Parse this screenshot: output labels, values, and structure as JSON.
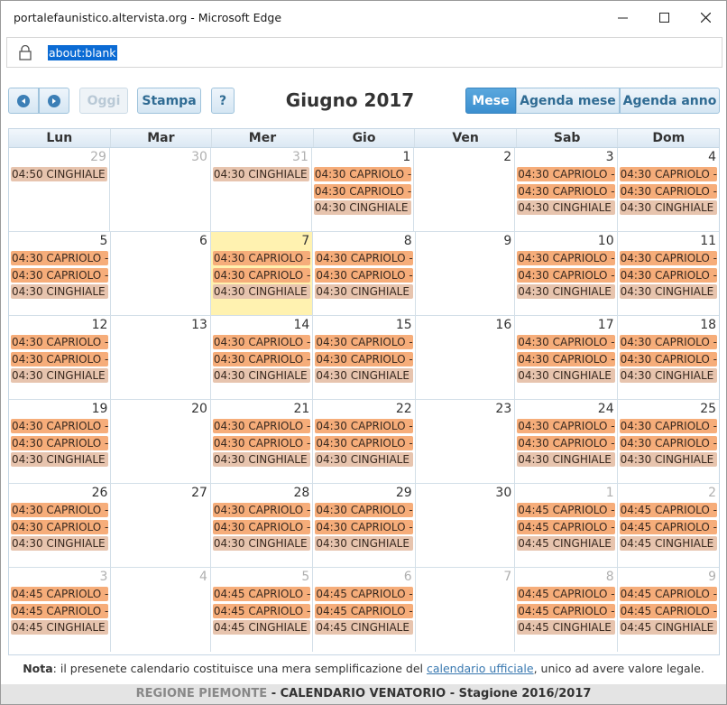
{
  "window": {
    "title": "portalefaunistico.altervista.org - Microsoft Edge",
    "url": "about:blank"
  },
  "toolbar": {
    "today_label": "Oggi",
    "print_label": "Stampa",
    "help_label": "?",
    "title": "Giugno 2017",
    "views": [
      "Mese",
      "Agenda mese",
      "Agenda anno"
    ],
    "active_view": "Mese"
  },
  "calendar": {
    "weekdays": [
      "Lun",
      "Mar",
      "Mer",
      "Gio",
      "Ven",
      "Sab",
      "Dom"
    ],
    "weeks": [
      [
        {
          "day": "29",
          "other": true,
          "events": [
            {
              "text": "04:50 CINGHIALE",
              "type": "cinghiale"
            }
          ]
        },
        {
          "day": "30",
          "other": true,
          "events": []
        },
        {
          "day": "31",
          "other": true,
          "events": [
            {
              "text": "04:30 CINGHIALE",
              "type": "cinghiale"
            }
          ]
        },
        {
          "day": "1",
          "events": [
            {
              "text": "04:30 CAPRIOLO -",
              "type": "capriolo"
            },
            {
              "text": "04:30 CAPRIOLO -",
              "type": "capriolo"
            },
            {
              "text": "04:30 CINGHIALE",
              "type": "cinghiale"
            }
          ]
        },
        {
          "day": "2",
          "events": []
        },
        {
          "day": "3",
          "events": [
            {
              "text": "04:30 CAPRIOLO -",
              "type": "capriolo"
            },
            {
              "text": "04:30 CAPRIOLO -",
              "type": "capriolo"
            },
            {
              "text": "04:30 CINGHIALE",
              "type": "cinghiale"
            }
          ]
        },
        {
          "day": "4",
          "events": [
            {
              "text": "04:30 CAPRIOLO -",
              "type": "capriolo"
            },
            {
              "text": "04:30 CAPRIOLO -",
              "type": "capriolo"
            },
            {
              "text": "04:30 CINGHIALE",
              "type": "cinghiale"
            }
          ]
        }
      ],
      [
        {
          "day": "5",
          "events": [
            {
              "text": "04:30 CAPRIOLO -",
              "type": "capriolo"
            },
            {
              "text": "04:30 CAPRIOLO -",
              "type": "capriolo"
            },
            {
              "text": "04:30 CINGHIALE",
              "type": "cinghiale"
            }
          ]
        },
        {
          "day": "6",
          "events": []
        },
        {
          "day": "7",
          "today": true,
          "events": [
            {
              "text": "04:30 CAPRIOLO -",
              "type": "capriolo"
            },
            {
              "text": "04:30 CAPRIOLO -",
              "type": "capriolo"
            },
            {
              "text": "04:30 CINGHIALE",
              "type": "cinghiale"
            }
          ]
        },
        {
          "day": "8",
          "events": [
            {
              "text": "04:30 CAPRIOLO -",
              "type": "capriolo"
            },
            {
              "text": "04:30 CAPRIOLO -",
              "type": "capriolo"
            },
            {
              "text": "04:30 CINGHIALE",
              "type": "cinghiale"
            }
          ]
        },
        {
          "day": "9",
          "events": []
        },
        {
          "day": "10",
          "events": [
            {
              "text": "04:30 CAPRIOLO -",
              "type": "capriolo"
            },
            {
              "text": "04:30 CAPRIOLO -",
              "type": "capriolo"
            },
            {
              "text": "04:30 CINGHIALE",
              "type": "cinghiale"
            }
          ]
        },
        {
          "day": "11",
          "events": [
            {
              "text": "04:30 CAPRIOLO -",
              "type": "capriolo"
            },
            {
              "text": "04:30 CAPRIOLO -",
              "type": "capriolo"
            },
            {
              "text": "04:30 CINGHIALE",
              "type": "cinghiale"
            }
          ]
        }
      ],
      [
        {
          "day": "12",
          "events": [
            {
              "text": "04:30 CAPRIOLO -",
              "type": "capriolo"
            },
            {
              "text": "04:30 CAPRIOLO -",
              "type": "capriolo"
            },
            {
              "text": "04:30 CINGHIALE",
              "type": "cinghiale"
            }
          ]
        },
        {
          "day": "13",
          "events": []
        },
        {
          "day": "14",
          "events": [
            {
              "text": "04:30 CAPRIOLO -",
              "type": "capriolo"
            },
            {
              "text": "04:30 CAPRIOLO -",
              "type": "capriolo"
            },
            {
              "text": "04:30 CINGHIALE",
              "type": "cinghiale"
            }
          ]
        },
        {
          "day": "15",
          "events": [
            {
              "text": "04:30 CAPRIOLO -",
              "type": "capriolo"
            },
            {
              "text": "04:30 CAPRIOLO -",
              "type": "capriolo"
            },
            {
              "text": "04:30 CINGHIALE",
              "type": "cinghiale"
            }
          ]
        },
        {
          "day": "16",
          "events": []
        },
        {
          "day": "17",
          "events": [
            {
              "text": "04:30 CAPRIOLO -",
              "type": "capriolo"
            },
            {
              "text": "04:30 CAPRIOLO -",
              "type": "capriolo"
            },
            {
              "text": "04:30 CINGHIALE",
              "type": "cinghiale"
            }
          ]
        },
        {
          "day": "18",
          "events": [
            {
              "text": "04:30 CAPRIOLO -",
              "type": "capriolo"
            },
            {
              "text": "04:30 CAPRIOLO -",
              "type": "capriolo"
            },
            {
              "text": "04:30 CINGHIALE",
              "type": "cinghiale"
            }
          ]
        }
      ],
      [
        {
          "day": "19",
          "events": [
            {
              "text": "04:30 CAPRIOLO -",
              "type": "capriolo"
            },
            {
              "text": "04:30 CAPRIOLO -",
              "type": "capriolo"
            },
            {
              "text": "04:30 CINGHIALE",
              "type": "cinghiale"
            }
          ]
        },
        {
          "day": "20",
          "events": []
        },
        {
          "day": "21",
          "events": [
            {
              "text": "04:30 CAPRIOLO -",
              "type": "capriolo"
            },
            {
              "text": "04:30 CAPRIOLO -",
              "type": "capriolo"
            },
            {
              "text": "04:30 CINGHIALE",
              "type": "cinghiale"
            }
          ]
        },
        {
          "day": "22",
          "events": [
            {
              "text": "04:30 CAPRIOLO -",
              "type": "capriolo"
            },
            {
              "text": "04:30 CAPRIOLO -",
              "type": "capriolo"
            },
            {
              "text": "04:30 CINGHIALE",
              "type": "cinghiale"
            }
          ]
        },
        {
          "day": "23",
          "events": []
        },
        {
          "day": "24",
          "events": [
            {
              "text": "04:30 CAPRIOLO -",
              "type": "capriolo"
            },
            {
              "text": "04:30 CAPRIOLO -",
              "type": "capriolo"
            },
            {
              "text": "04:30 CINGHIALE",
              "type": "cinghiale"
            }
          ]
        },
        {
          "day": "25",
          "events": [
            {
              "text": "04:30 CAPRIOLO -",
              "type": "capriolo"
            },
            {
              "text": "04:30 CAPRIOLO -",
              "type": "capriolo"
            },
            {
              "text": "04:30 CINGHIALE",
              "type": "cinghiale"
            }
          ]
        }
      ],
      [
        {
          "day": "26",
          "events": [
            {
              "text": "04:30 CAPRIOLO -",
              "type": "capriolo"
            },
            {
              "text": "04:30 CAPRIOLO -",
              "type": "capriolo"
            },
            {
              "text": "04:30 CINGHIALE",
              "type": "cinghiale"
            }
          ]
        },
        {
          "day": "27",
          "events": []
        },
        {
          "day": "28",
          "events": [
            {
              "text": "04:30 CAPRIOLO -",
              "type": "capriolo"
            },
            {
              "text": "04:30 CAPRIOLO -",
              "type": "capriolo"
            },
            {
              "text": "04:30 CINGHIALE",
              "type": "cinghiale"
            }
          ]
        },
        {
          "day": "29",
          "events": [
            {
              "text": "04:30 CAPRIOLO -",
              "type": "capriolo"
            },
            {
              "text": "04:30 CAPRIOLO -",
              "type": "capriolo"
            },
            {
              "text": "04:30 CINGHIALE",
              "type": "cinghiale"
            }
          ]
        },
        {
          "day": "30",
          "events": []
        },
        {
          "day": "1",
          "other": true,
          "events": [
            {
              "text": "04:45 CAPRIOLO -",
              "type": "capriolo"
            },
            {
              "text": "04:45 CAPRIOLO -",
              "type": "capriolo"
            },
            {
              "text": "04:45 CINGHIALE",
              "type": "cinghiale"
            }
          ]
        },
        {
          "day": "2",
          "other": true,
          "events": [
            {
              "text": "04:45 CAPRIOLO -",
              "type": "capriolo"
            },
            {
              "text": "04:45 CAPRIOLO -",
              "type": "capriolo"
            },
            {
              "text": "04:45 CINGHIALE",
              "type": "cinghiale"
            }
          ]
        }
      ],
      [
        {
          "day": "3",
          "other": true,
          "events": [
            {
              "text": "04:45 CAPRIOLO -",
              "type": "capriolo"
            },
            {
              "text": "04:45 CAPRIOLO -",
              "type": "capriolo"
            },
            {
              "text": "04:45 CINGHIALE",
              "type": "cinghiale"
            }
          ]
        },
        {
          "day": "4",
          "other": true,
          "events": []
        },
        {
          "day": "5",
          "other": true,
          "events": [
            {
              "text": "04:45 CAPRIOLO -",
              "type": "capriolo"
            },
            {
              "text": "04:45 CAPRIOLO -",
              "type": "capriolo"
            },
            {
              "text": "04:45 CINGHIALE",
              "type": "cinghiale"
            }
          ]
        },
        {
          "day": "6",
          "other": true,
          "events": [
            {
              "text": "04:45 CAPRIOLO -",
              "type": "capriolo"
            },
            {
              "text": "04:45 CAPRIOLO -",
              "type": "capriolo"
            },
            {
              "text": "04:45 CINGHIALE",
              "type": "cinghiale"
            }
          ]
        },
        {
          "day": "7",
          "other": true,
          "events": []
        },
        {
          "day": "8",
          "other": true,
          "events": [
            {
              "text": "04:45 CAPRIOLO -",
              "type": "capriolo"
            },
            {
              "text": "04:45 CAPRIOLO -",
              "type": "capriolo"
            },
            {
              "text": "04:45 CINGHIALE",
              "type": "cinghiale"
            }
          ]
        },
        {
          "day": "9",
          "other": true,
          "events": [
            {
              "text": "04:45 CAPRIOLO -",
              "type": "capriolo"
            },
            {
              "text": "04:45 CAPRIOLO -",
              "type": "capriolo"
            },
            {
              "text": "04:45 CINGHIALE",
              "type": "cinghiale"
            }
          ]
        }
      ]
    ]
  },
  "note": {
    "label": "Nota",
    "text_before": ": il presenete calendario costituisce una mera semplificazione del ",
    "link": "calendario ufficiale",
    "text_after": ", unico ad avere valore legale."
  },
  "footer": {
    "region": "REGIONE PIEMONTE",
    "separator": " - ",
    "title": "CALENDARIO VENATORIO - Stagione 2016/2017"
  },
  "colors": {
    "capriolo": "#f6ad7a",
    "cinghiale": "#e7c4ae",
    "today": "#fff2b0",
    "accent": "#3b8fcf"
  }
}
